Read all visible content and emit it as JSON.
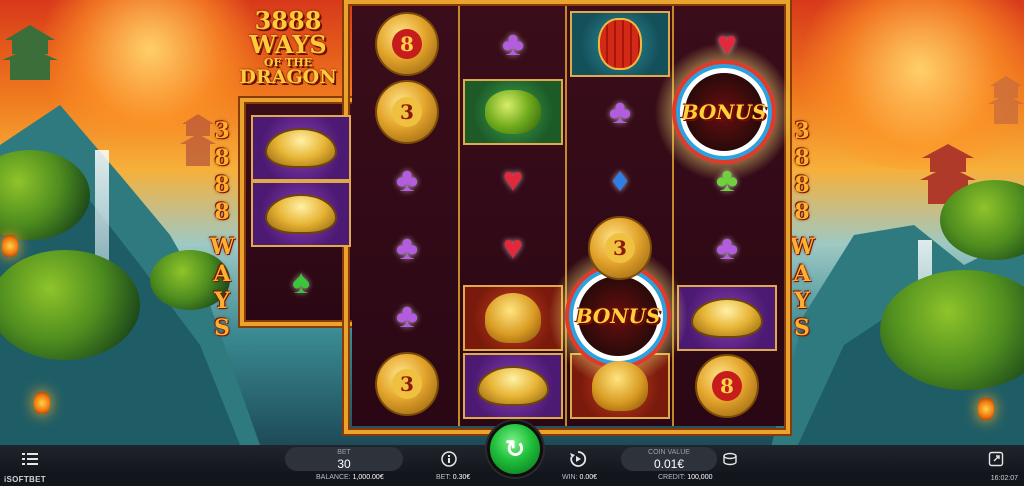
{
  "game": {
    "logo_line1": "3888",
    "logo_line2": "WAYS",
    "logo_line3": "OF THE",
    "logo_line4": "DRAGON",
    "side_left": [
      "3",
      "8",
      "8",
      "8",
      "W",
      "A",
      "Y",
      "S"
    ],
    "side_right": [
      "3",
      "8",
      "8",
      "8",
      "W",
      "A",
      "Y",
      "S"
    ]
  },
  "reels": {
    "bonus_label": "BONUS",
    "coin_3": "3",
    "coin_8": "8",
    "suits": {
      "club": "♣",
      "heart": "♥",
      "diamond": "♦",
      "spade": "♠"
    },
    "colors": {
      "club": "#b45ce0",
      "heart": "#e2283a",
      "diamond": "#2f7ee6",
      "spade": "#3cc43a",
      "club_green": "#6fd23a"
    }
  },
  "controls": {
    "menu_icon": "menu-icon",
    "bet_label": "BET",
    "bet_value": "30",
    "info_icon": "info-icon",
    "spin_icon": "↻",
    "autoplay_icon": "autoplay-icon",
    "coin_value_label": "COIN VALUE",
    "coin_value": "0.01€",
    "coin_icon": "coin-stack-icon",
    "fullscreen_icon": "fullscreen-icon"
  },
  "status": {
    "brand": "iSOFTBET",
    "balance_label": "BALANCE:",
    "balance_value": "1,000.00€",
    "bet_label": "BET:",
    "bet_value": "0.30€",
    "win_label": "WIN:",
    "win_value": "0.00€",
    "credit_label": "CREDIT:",
    "credit_value": "100,000",
    "time": "16:02:07"
  }
}
